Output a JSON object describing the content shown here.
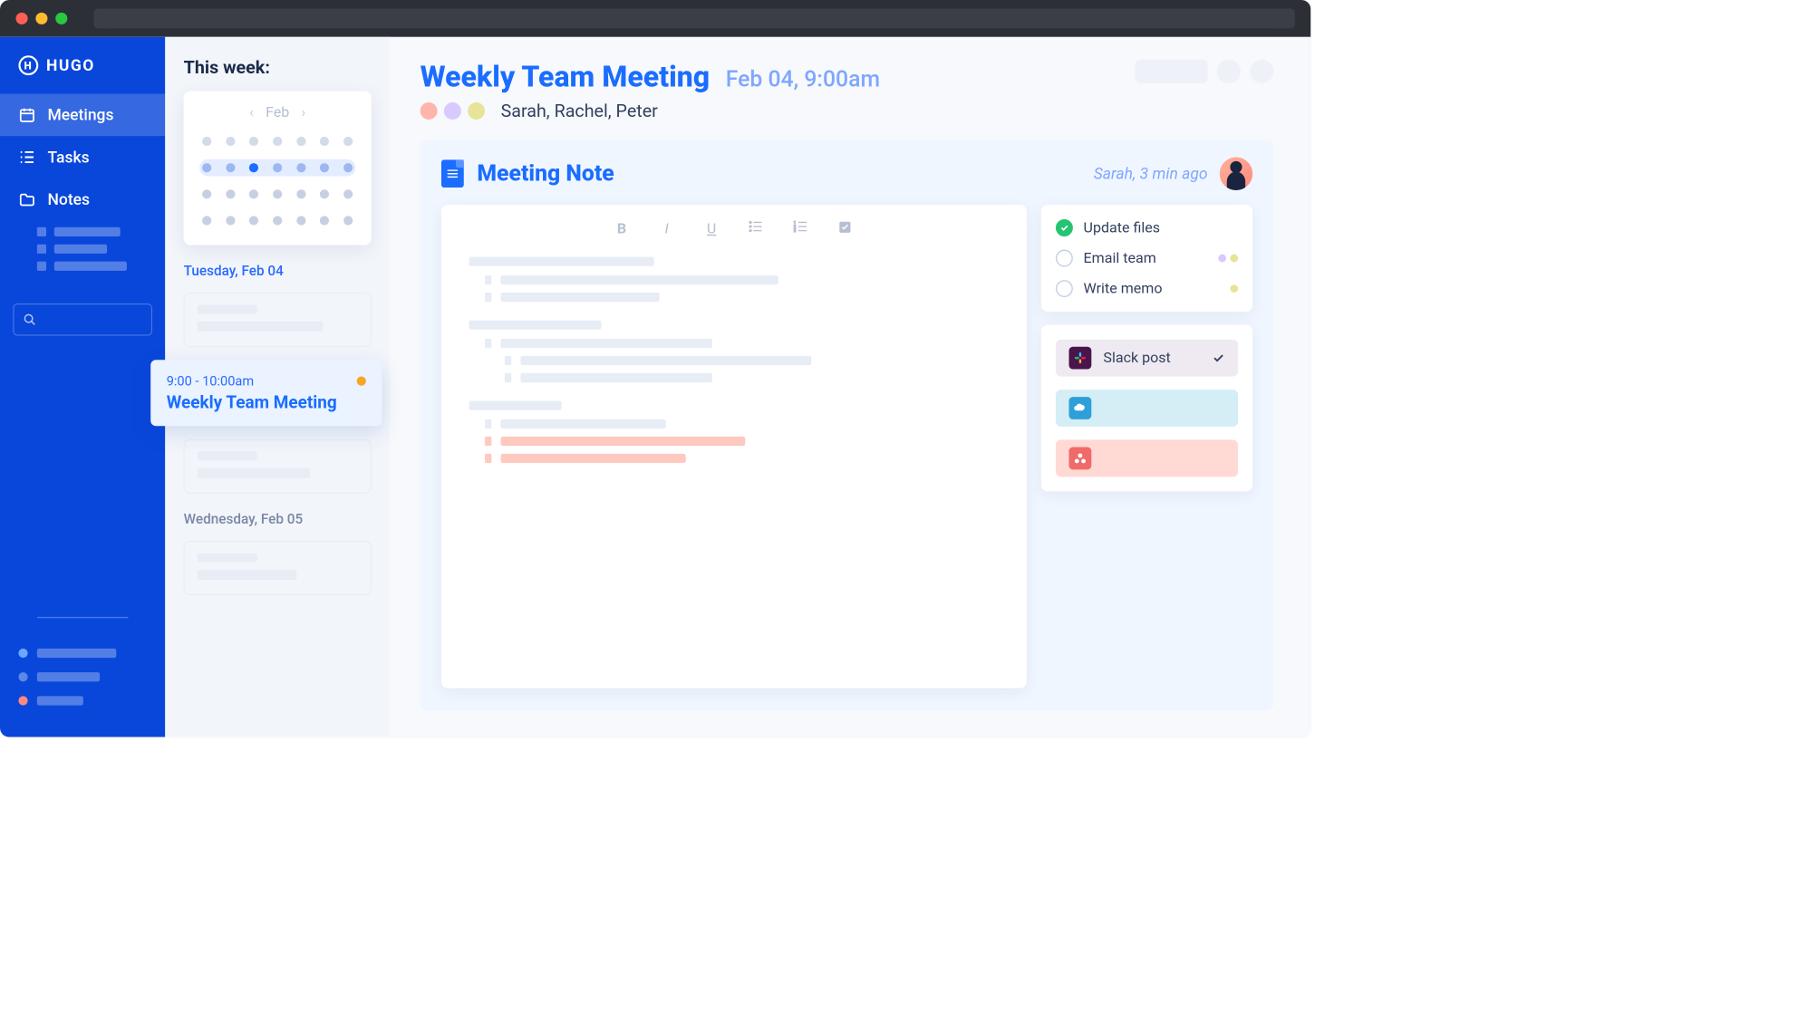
{
  "brand": "HUGO",
  "nav": {
    "meetings": "Meetings",
    "tasks": "Tasks",
    "notes": "Notes"
  },
  "week": {
    "heading": "This week:",
    "month": "Feb",
    "days": {
      "tuesday": "Tuesday, Feb 04",
      "wednesday": "Wednesday, Feb 05"
    },
    "selected_event": {
      "time": "9:00 - 10:00am",
      "title": "Weekly Team Meeting"
    }
  },
  "meeting": {
    "title": "Weekly Team Meeting",
    "datetime": "Feb 04, 9:00am",
    "attendees": "Sarah, Rachel, Peter",
    "attendee_colors": [
      "#ffb5ac",
      "#d8c9ff",
      "#e7e49a"
    ]
  },
  "note": {
    "heading": "Meeting Note",
    "meta": "Sarah, 3 min ago"
  },
  "tasks": [
    {
      "label": "Update files",
      "done": true,
      "dots": []
    },
    {
      "label": "Email team",
      "done": false,
      "dots": [
        "#d8c9ff",
        "#e7e49a"
      ]
    },
    {
      "label": "Write memo",
      "done": false,
      "dots": [
        "#e7e49a"
      ]
    }
  ],
  "integrations": {
    "slack": "Slack post"
  }
}
